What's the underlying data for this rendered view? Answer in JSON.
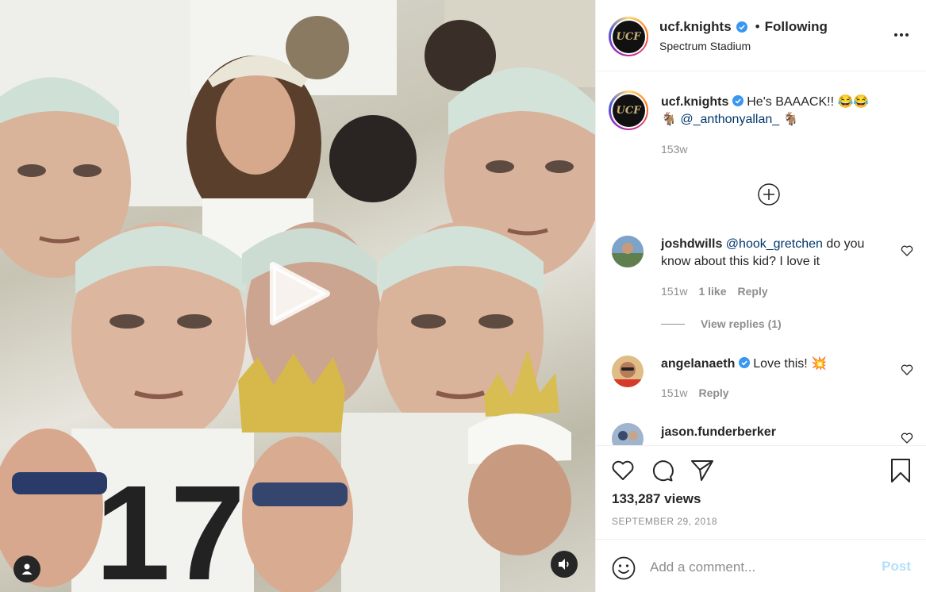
{
  "header": {
    "username": "ucf.knights",
    "follow_separator": "•",
    "follow_status": "Following",
    "location": "Spectrum Stadium",
    "avatar_initials": "UCF",
    "more_icon": "more-horizontal-icon"
  },
  "caption": {
    "username": "ucf.knights",
    "text": "He's BAAACK!! 😂😂",
    "line2_emoji_left": "🐐",
    "mention": "@_anthonyallan_",
    "line2_emoji_right": "🐐",
    "time": "153w"
  },
  "comments": [
    {
      "username": "joshdwills",
      "mention": "@hook_gretchen",
      "text": "do you know about this kid? I love it",
      "time": "151w",
      "likes": "1 like",
      "reply_label": "Reply",
      "view_replies": "View replies (1)"
    },
    {
      "username": "angelanaeth",
      "text": "Love this!",
      "emoji": "💥",
      "time": "151w",
      "reply_label": "Reply"
    },
    {
      "username": "jason.funderberker"
    }
  ],
  "actions": {
    "views": "133,287 views",
    "date": "SEPTEMBER 29, 2018",
    "icons": [
      "heart-icon",
      "comment-icon",
      "share-icon",
      "bookmark-icon"
    ]
  },
  "add_comment": {
    "placeholder": "Add a comment...",
    "post_label": "Post"
  },
  "colors": {
    "link": "#00376b",
    "secondary_text": "#8e8e8e",
    "verified": "#3897f0",
    "post_disabled": "#b2dffc"
  }
}
